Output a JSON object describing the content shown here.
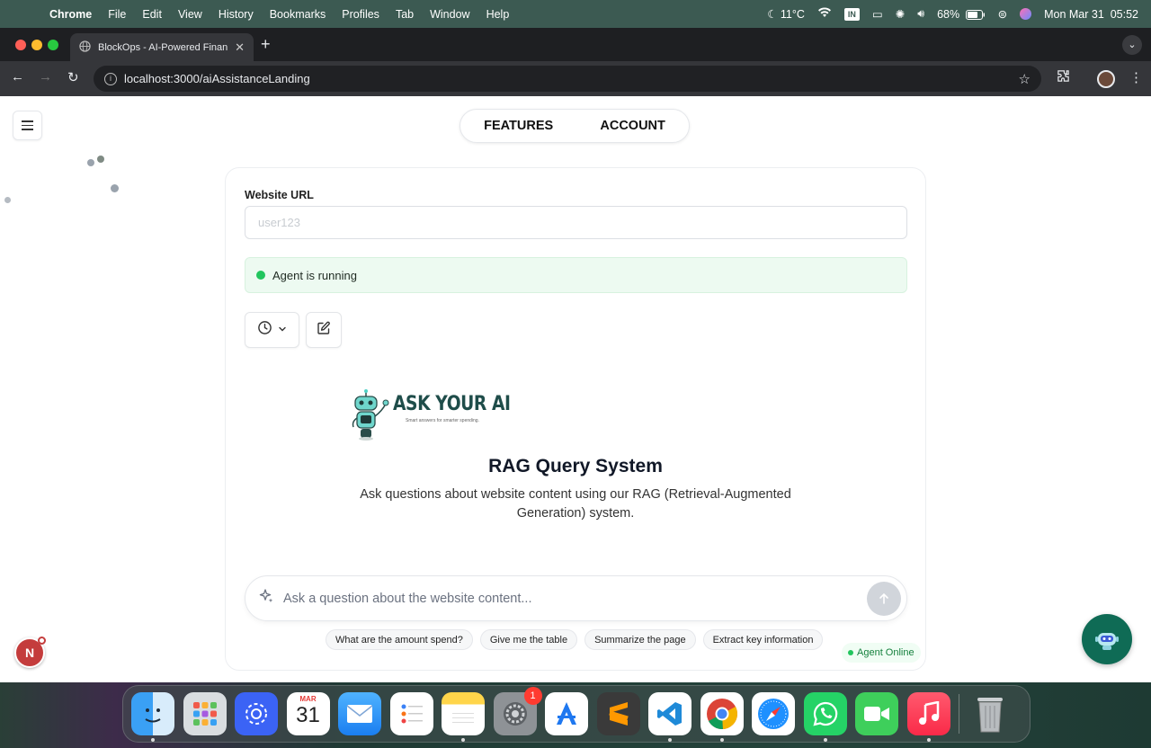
{
  "menubar": {
    "app_name": "Chrome",
    "items": [
      "File",
      "Edit",
      "View",
      "History",
      "Bookmarks",
      "Profiles",
      "Tab",
      "Window",
      "Help"
    ],
    "weather": "11°C",
    "input_source": "IN",
    "battery": "68%",
    "datetime": "Mon Mar 31  05:52"
  },
  "browser": {
    "tab_title": "BlockOps - AI-Powered Finan",
    "url": "localhost:3000/aiAssistanceLanding"
  },
  "page": {
    "nav": {
      "features": "FEATURES",
      "account": "ACCOUNT"
    },
    "website_url_label": "Website URL",
    "website_url_placeholder": "user123",
    "status_text": "Agent is running",
    "logo": {
      "title": "ASK YOUR AI",
      "tagline": "Smart answers for smarter spending."
    },
    "hero_title": "RAG Query System",
    "hero_subtitle": "Ask questions about website content using our RAG (Retrieval-Augmented Generation) system.",
    "ask_placeholder": "Ask a question about the website content...",
    "suggestions": [
      "What are the amount spend?",
      "Give me the table",
      "Summarize the page",
      "Extract key information"
    ],
    "agent_online": "Agent Online",
    "n_badge": "N"
  },
  "dock": {
    "calendar_month": "MAR",
    "calendar_day": "31",
    "settings_badge": "1"
  },
  "colors": {
    "accent_green": "#22c55e",
    "bot_fab": "#0f6b55",
    "logo_text": "#1f4d4a"
  }
}
